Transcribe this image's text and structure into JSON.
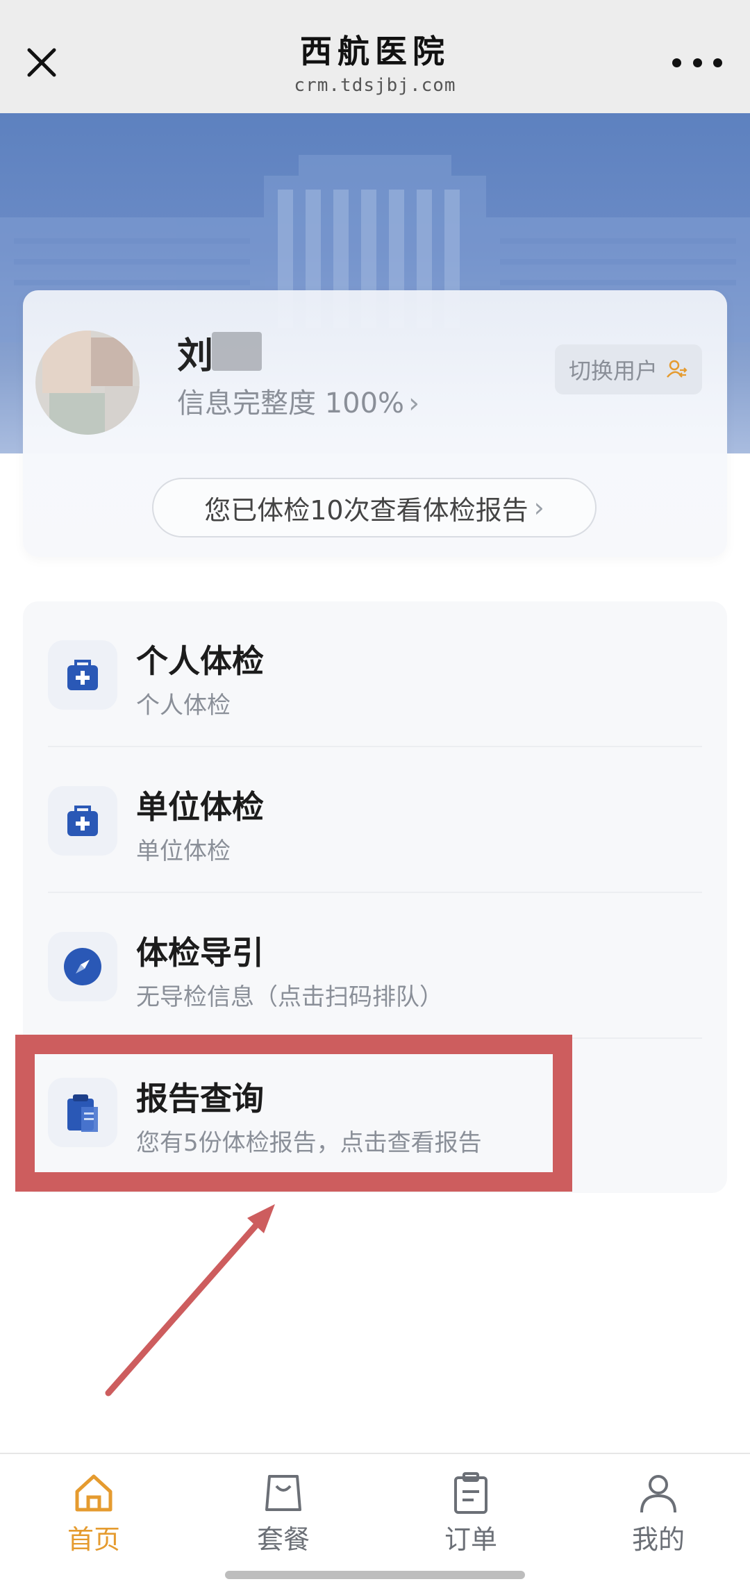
{
  "header": {
    "title": "西航医院",
    "url": "crm.tdsjbj.com"
  },
  "profile": {
    "name": "刘",
    "completeness": "信息完整度 100%",
    "switch_user": "切换用户",
    "check_history": "您已体检10次查看体检报告"
  },
  "menu": {
    "items": [
      {
        "title": "个人体检",
        "subtitle": "个人体检",
        "icon": "medical-kit-icon"
      },
      {
        "title": "单位体检",
        "subtitle": "单位体检",
        "icon": "medical-kit-icon"
      },
      {
        "title": "体检导引",
        "subtitle": "无导检信息（点击扫码排队）",
        "icon": "compass-icon"
      },
      {
        "title": "报告查询",
        "subtitle": "您有5份体检报告，点击查看报告",
        "icon": "clipboard-report-icon"
      }
    ]
  },
  "bottom_nav": {
    "items": [
      {
        "label": "首页",
        "icon": "home-icon",
        "active": true
      },
      {
        "label": "套餐",
        "icon": "bag-icon",
        "active": false
      },
      {
        "label": "订单",
        "icon": "clipboard-icon",
        "active": false
      },
      {
        "label": "我的",
        "icon": "user-icon",
        "active": false
      }
    ]
  },
  "colors": {
    "accent": "#e59b2f",
    "highlight": "#cd5d5e",
    "icon_blue": "#2a58b6"
  }
}
